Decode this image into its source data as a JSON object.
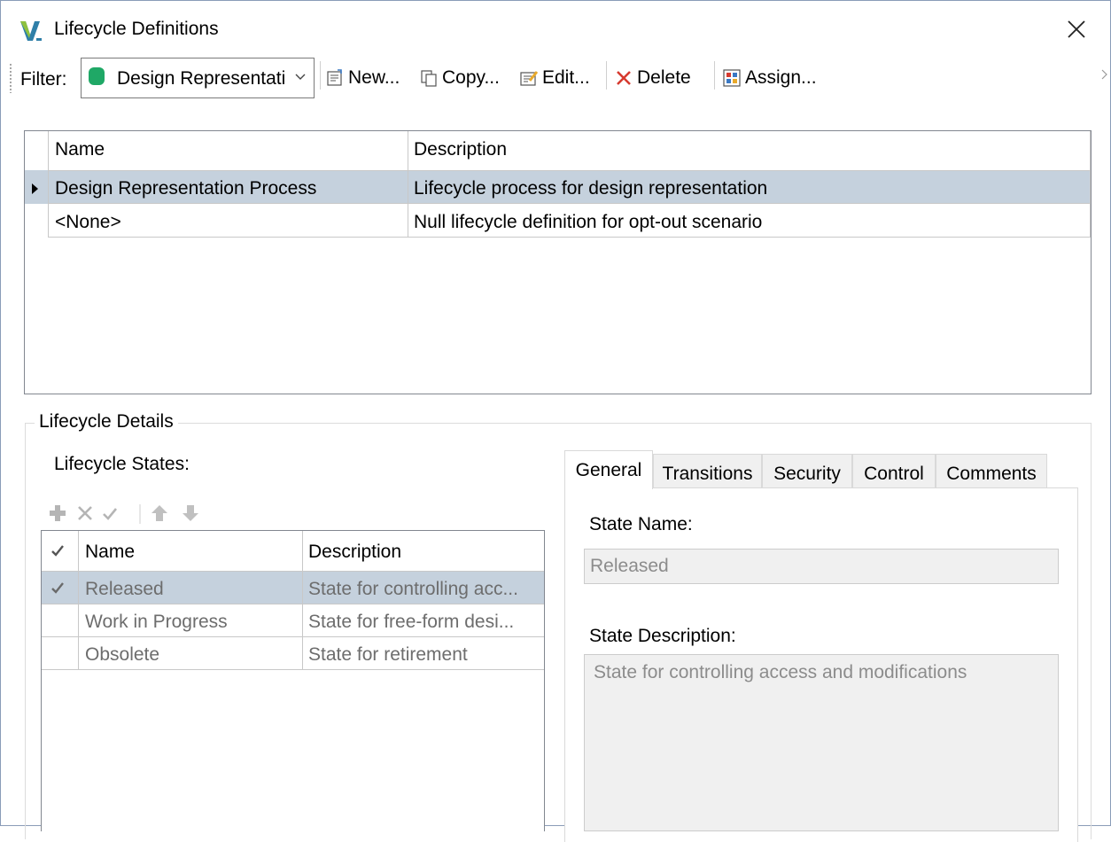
{
  "window": {
    "title": "Lifecycle Definitions"
  },
  "toolbar": {
    "filter_label": "Filter:",
    "filter_value": "Design Representation Process",
    "filter_color": "#1fa866",
    "new_label": "New...",
    "copy_label": "Copy...",
    "edit_label": "Edit...",
    "delete_label": "Delete",
    "assign_label": "Assign..."
  },
  "definitions": {
    "columns": [
      "Name",
      "Description"
    ],
    "rows": [
      {
        "name": "Design Representation Process",
        "description": "Lifecycle process for design representation",
        "selected": true
      },
      {
        "name": "<None>",
        "description": "Null lifecycle definition for opt-out scenario",
        "selected": false
      }
    ]
  },
  "details": {
    "group_label": "Lifecycle Details",
    "states_label": "Lifecycle States:",
    "states_columns": [
      "Name",
      "Description"
    ],
    "states": [
      {
        "name": "Released",
        "description": "State for controlling acc...",
        "checked": true,
        "selected": true
      },
      {
        "name": "Work in Progress",
        "description": "State for free-form desi...",
        "checked": false,
        "selected": false
      },
      {
        "name": "Obsolete",
        "description": "State for retirement",
        "checked": false,
        "selected": false
      }
    ],
    "tabs": [
      "General",
      "Transitions",
      "Security",
      "Control",
      "Comments"
    ],
    "active_tab": "General",
    "general": {
      "state_name_label": "State Name:",
      "state_name_value": "Released",
      "state_description_label": "State Description:",
      "state_description_value": "State for controlling access and modifications"
    }
  },
  "colors": {
    "selection": "#c5d1dd",
    "grid_border": "#828790"
  }
}
